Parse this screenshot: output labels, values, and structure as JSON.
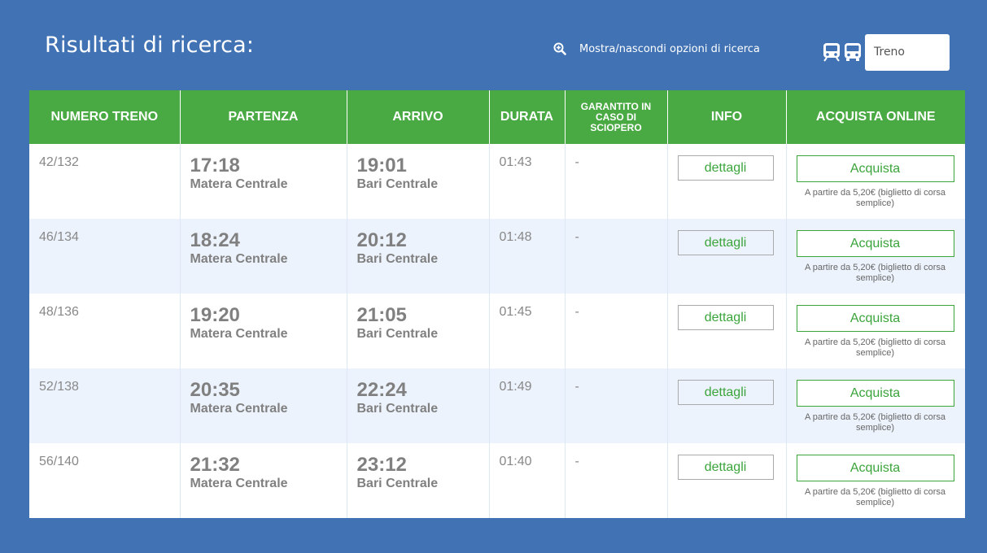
{
  "header": {
    "title": "Risultati di ricerca:",
    "toggle_label": "Mostra/nascondi opzioni di ricerca",
    "mode_select_value": "Treno"
  },
  "table": {
    "columns": [
      "NUMERO TRENO",
      "PARTENZA",
      "ARRIVO",
      "DURATA",
      "GARANTITO IN CASO DI SCIOPERO",
      "INFO",
      "ACQUISTA ONLINE"
    ],
    "rows": [
      {
        "number": "42/132",
        "dep_time": "17:18",
        "dep_station": "Matera Centrale",
        "arr_time": "19:01",
        "arr_station": "Bari Centrale",
        "duration": "01:43",
        "guaranteed": "-",
        "info_label": "dettagli",
        "buy_label": "Acquista",
        "price_note": "A partire da 5,20€ (biglietto di corsa semplice)"
      },
      {
        "number": "46/134",
        "dep_time": "18:24",
        "dep_station": "Matera Centrale",
        "arr_time": "20:12",
        "arr_station": "Bari Centrale",
        "duration": "01:48",
        "guaranteed": "-",
        "info_label": "dettagli",
        "buy_label": "Acquista",
        "price_note": "A partire da 5,20€ (biglietto di corsa semplice)"
      },
      {
        "number": "48/136",
        "dep_time": "19:20",
        "dep_station": "Matera Centrale",
        "arr_time": "21:05",
        "arr_station": "Bari Centrale",
        "duration": "01:45",
        "guaranteed": "-",
        "info_label": "dettagli",
        "buy_label": "Acquista",
        "price_note": "A partire da 5,20€ (biglietto di corsa semplice)"
      },
      {
        "number": "52/138",
        "dep_time": "20:35",
        "dep_station": "Matera Centrale",
        "arr_time": "22:24",
        "arr_station": "Bari Centrale",
        "duration": "01:49",
        "guaranteed": "-",
        "info_label": "dettagli",
        "buy_label": "Acquista",
        "price_note": "A partire da 5,20€ (biglietto di corsa semplice)"
      },
      {
        "number": "56/140",
        "dep_time": "21:32",
        "dep_station": "Matera Centrale",
        "arr_time": "23:12",
        "arr_station": "Bari Centrale",
        "duration": "01:40",
        "guaranteed": "-",
        "info_label": "dettagli",
        "buy_label": "Acquista",
        "price_note": "A partire da 5,20€ (biglietto di corsa semplice)"
      }
    ]
  },
  "icons": {
    "toggle": "zoom-in-icon",
    "train": "train-icon",
    "bus": "bus-icon"
  },
  "colors": {
    "background": "#4072b4",
    "header_green": "#49a942",
    "accent_green": "#3ba43b",
    "row_alt": "#edf3fd"
  }
}
